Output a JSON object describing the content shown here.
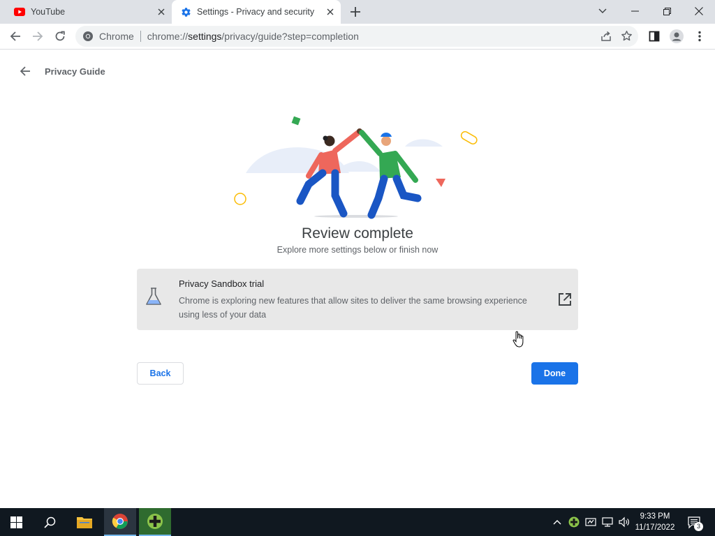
{
  "tabs": [
    {
      "title": "YouTube",
      "active": false,
      "icon": "youtube-icon"
    },
    {
      "title": "Settings - Privacy and security",
      "active": true,
      "icon": "settings-gear-icon"
    }
  ],
  "toolbar": {
    "site_label": "Chrome",
    "url_prefix": "chrome://",
    "url_host": "settings",
    "url_path": "/privacy/guide?step=completion"
  },
  "page": {
    "title": "Privacy Guide",
    "heading": "Review complete",
    "subheading": "Explore more settings below or finish now"
  },
  "card": {
    "title": "Privacy Sandbox trial",
    "description": "Chrome is exploring new features that allow sites to deliver the same browsing experience using less of your data"
  },
  "buttons": {
    "back": "Back",
    "done": "Done"
  },
  "taskbar": {
    "time": "9:33 PM",
    "date": "11/17/2022",
    "notification_count": "3"
  },
  "colors": {
    "accent": "#1a73e8",
    "tabstrip": "#dee1e6",
    "card_bg": "#e8e8e8",
    "taskbar": "#101820"
  }
}
